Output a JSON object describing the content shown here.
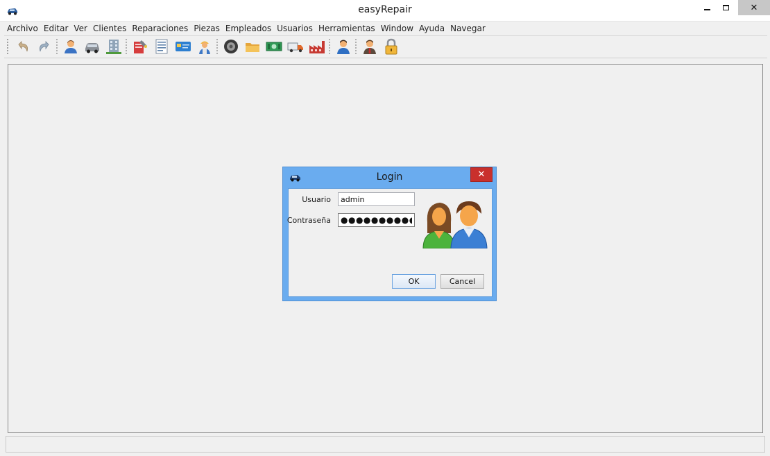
{
  "window": {
    "title": "easyRepair",
    "minimize_glyph": "",
    "close_glyph": "✕"
  },
  "menu": {
    "items": [
      "Archivo",
      "Editar",
      "Ver",
      "Clientes",
      "Reparaciones",
      "Piezas",
      "Empleados",
      "Usuarios",
      "Herramientas",
      "Window",
      "Ayuda",
      "Navegar"
    ]
  },
  "toolbar": {
    "icons": [
      "undo-icon",
      "redo-icon",
      "client-icon",
      "car-icon",
      "building-icon",
      "repair-order-icon",
      "document-list-icon",
      "card-icon",
      "worker-icon",
      "tire-icon",
      "folder-icon",
      "money-icon",
      "truck-icon",
      "factory-icon",
      "employee-icon",
      "user-admin-icon",
      "lock-icon"
    ]
  },
  "login": {
    "title": "Login",
    "close_glyph": "✕",
    "user_label": "Usuario",
    "user_value": "admin",
    "password_label": "Contraseña",
    "password_value": "●●●●●●●●●●",
    "ok_label": "OK",
    "cancel_label": "Cancel"
  },
  "colors": {
    "dialog_frame": "#6aacef",
    "dialog_close": "#c9302c",
    "ok_border": "#6ea5e1"
  }
}
